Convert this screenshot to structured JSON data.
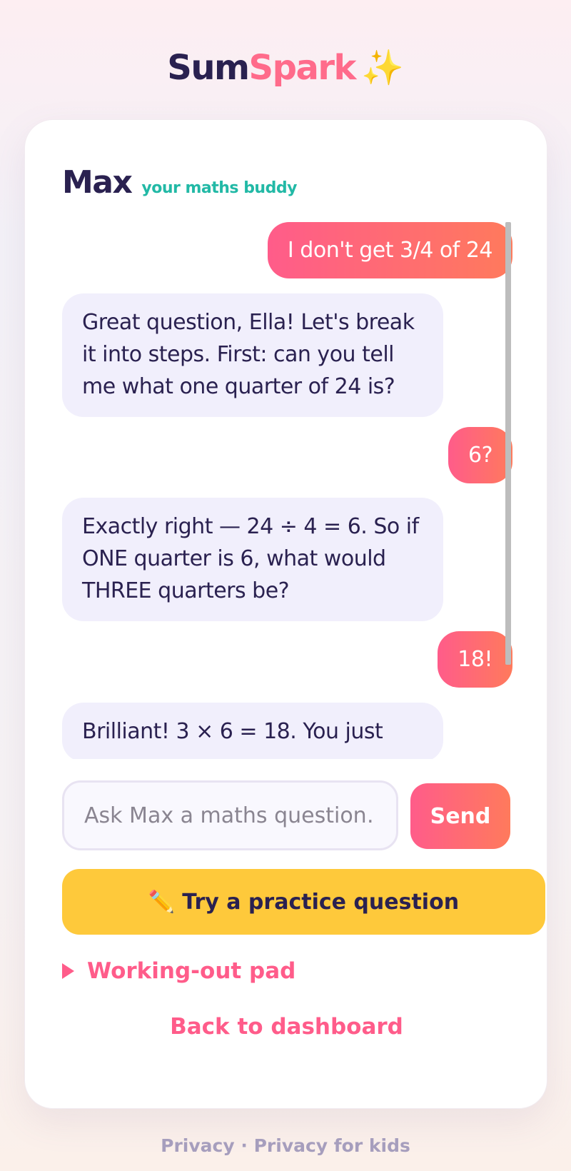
{
  "brand": {
    "part1": "Sum",
    "part2": "Spark",
    "sparkle": "✨"
  },
  "chat_header": {
    "name": "Max",
    "subtitle": "your maths buddy"
  },
  "messages": [
    {
      "role": "user",
      "text": "I don't get 3/4 of 24"
    },
    {
      "role": "bot",
      "text": "Great question, Ella! Let's break it into steps. First: can you tell me what one quarter of 24 is?"
    },
    {
      "role": "user",
      "text": "6?"
    },
    {
      "role": "bot",
      "text": "Exactly right — 24 ÷ 4 = 6. So if ONE quarter is 6, what would THREE quarters be?"
    },
    {
      "role": "user",
      "text": "18!"
    },
    {
      "role": "bot",
      "text": "Brilliant! 3 × 6 = 18. You just"
    }
  ],
  "input": {
    "placeholder": "Ask Max a maths question…",
    "value": ""
  },
  "buttons": {
    "send": "Send",
    "practice_icon": "✏️",
    "practice_label": "Try a practice question"
  },
  "working_pad": {
    "label": "Working-out pad",
    "icon": "disclosure-triangle-icon"
  },
  "back_link": "Back to dashboard",
  "footer": {
    "privacy": "Privacy",
    "separator": "·",
    "privacy_kids": "Privacy for kids"
  },
  "colors": {
    "accent_gradient_start": "#ff5c8a",
    "accent_gradient_end": "#ff7a5c",
    "bot_bubble": "#f1effc",
    "practice_button": "#fec93b",
    "subtitle_teal": "#22b9a6",
    "text_dark": "#2a2150"
  }
}
